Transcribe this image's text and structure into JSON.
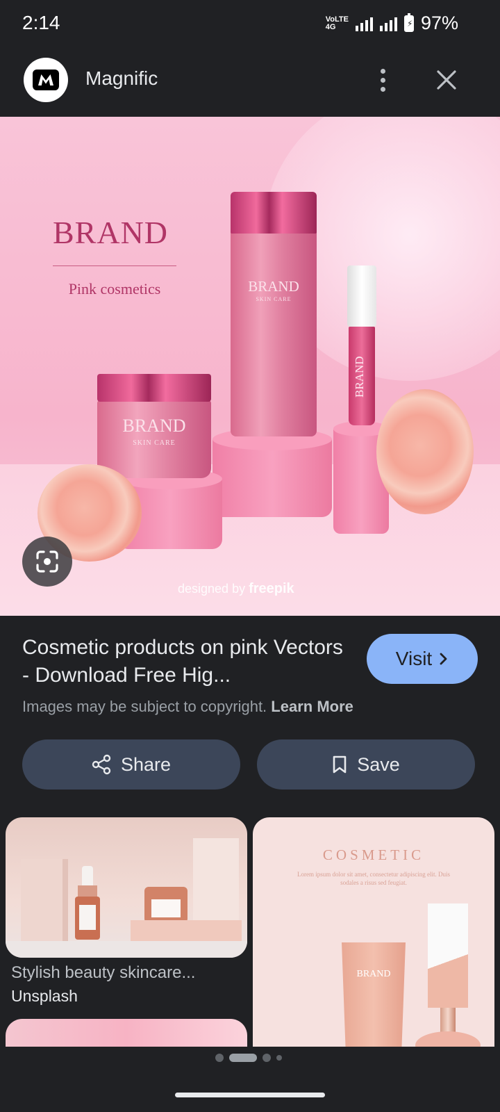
{
  "status_bar": {
    "time": "2:14",
    "network_top": "VoLTE",
    "network_bottom": "4G",
    "battery": "97%"
  },
  "header": {
    "site_name": "Magnific",
    "menu_icon": "more-vert-icon",
    "close_icon": "close-icon"
  },
  "hero": {
    "brand": "BRAND",
    "tagline": "Pink cosmetics",
    "bottle_brand": "BRAND",
    "bottle_sub": "SKIN CARE",
    "jar_brand": "BRAND",
    "jar_sub": "SKIN CARE",
    "gloss_brand": "BRAND",
    "watermark_prefix": "designed by",
    "watermark_brand": "freepik"
  },
  "result": {
    "title": "Cosmetic products on pink Vectors - Download Free Hig...",
    "visit_label": "Visit",
    "copyright_text": "Images may be subject to copyright.",
    "learn_more": "Learn More",
    "share_label": "Share",
    "save_label": "Save"
  },
  "related": [
    {
      "title": "Stylish beauty skincare...",
      "source": "Unsplash"
    },
    {
      "heading": "COSMETIC",
      "body": "Lorem ipsum dolor sit amet, consectetur adipiscing elit. Duis sodales a risus sed feugiat.",
      "product_brand": "BRAND"
    }
  ],
  "colors": {
    "background": "#202124",
    "visit_button": "#8ab4f8",
    "pill_button": "#3c4659"
  }
}
